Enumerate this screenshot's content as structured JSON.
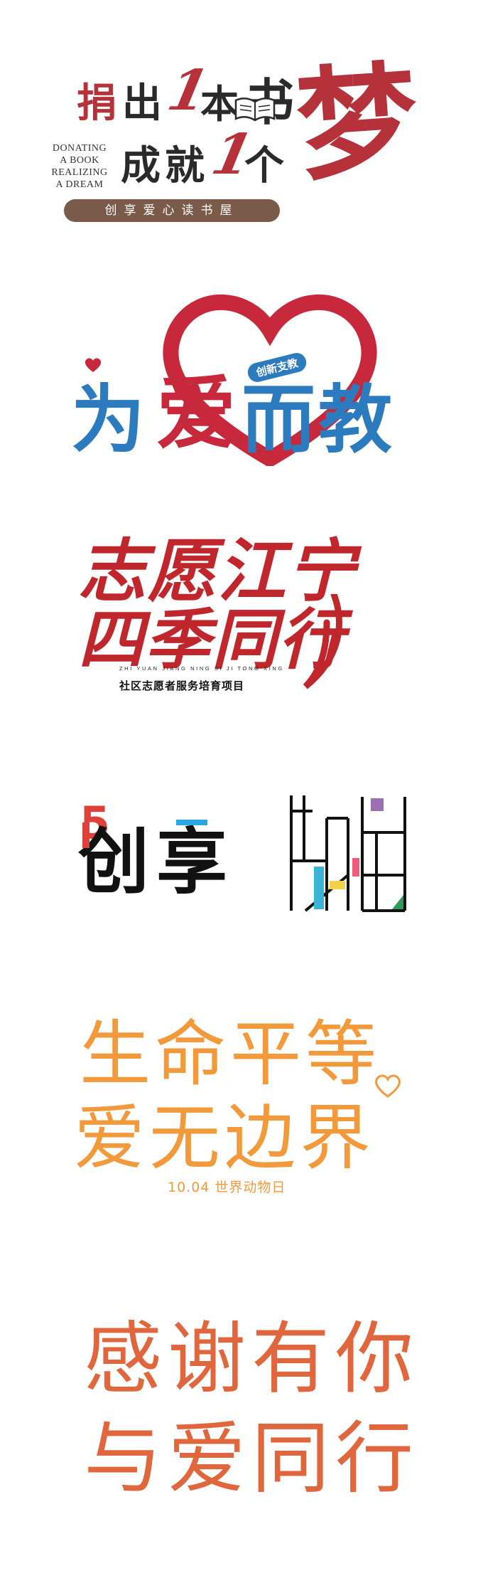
{
  "logo_books": {
    "line1": [
      "捐",
      "出",
      "1",
      "本",
      "书"
    ],
    "line2": [
      "成",
      "就",
      "1",
      "个"
    ],
    "dream_char": "梦",
    "english_lines": [
      "DONATING",
      "A BOOK",
      "REALIZING",
      "A DREAM"
    ],
    "tagline": "创享爱心读书屋",
    "colors": {
      "red": "#b5323a",
      "dark": "#2a2a2a",
      "bar": "#7a5a48"
    }
  },
  "logo_teach": {
    "chars": [
      "为",
      "爱",
      "而",
      "教"
    ],
    "badge": "创新支教",
    "colors": {
      "blue": "#2d7bbf",
      "red": "#c8283c"
    }
  },
  "logo_volunteer": {
    "line1": "志愿江宁",
    "line2": "四季同行",
    "pinyin": "ZHI YUAN JIANG NING SI JI TONG XING",
    "subtitle": "社区志愿者服务培育项目",
    "color": "#c0272d"
  },
  "logo_chuangxiang": {
    "chars": [
      "创",
      "享"
    ],
    "numeral": "5",
    "colors": {
      "red": "#e0403a",
      "blue": "#2aa6e0",
      "black": "#111111"
    }
  },
  "logo_line_art": {
    "colors": {
      "purple": "#9b6fb0",
      "pink": "#f05a7a",
      "yellow": "#f2d24a",
      "cyan": "#3bb5d6",
      "green": "#2e9b57"
    }
  },
  "logo_animal": {
    "line1": "生命平等",
    "line2": "爱无边界",
    "caption": "10.04 世界动物日",
    "color": "#f29a3b"
  },
  "logo_thanks": {
    "line1": "感谢有你",
    "line2": "与爱同行",
    "color": "#e0673d"
  }
}
